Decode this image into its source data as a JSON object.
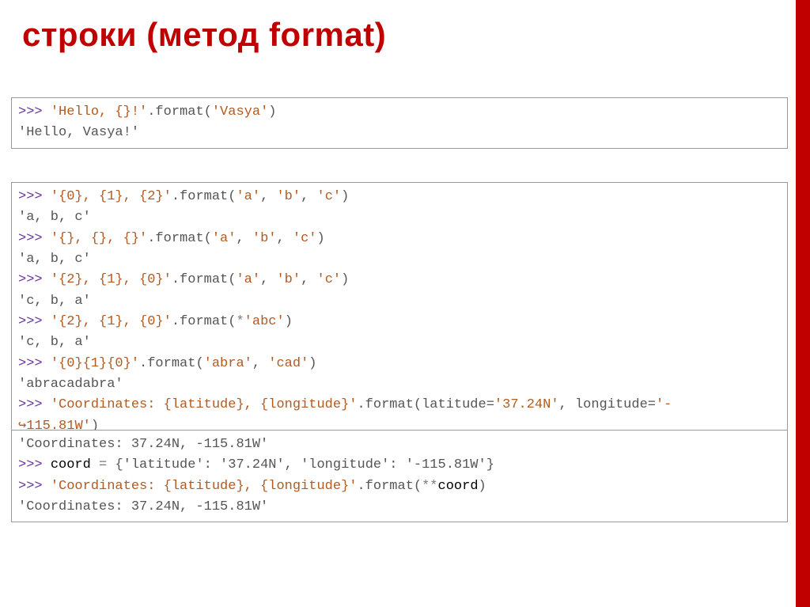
{
  "title": "строки (метод format)",
  "block1": {
    "l1": {
      "p": ">>> ",
      "code_a": "'Hello, {}!'",
      "code_b": ".format(",
      "code_c": "'Vasya'",
      "code_d": ")"
    },
    "l2": "'Hello, Vasya!'"
  },
  "block2": {
    "l1": {
      "p": ">>> ",
      "s": "'{0}, {1}, {2}'",
      "m": ".format(",
      "a": "'a'",
      "c1": ", ",
      "b": "'b'",
      "c2": ", ",
      "c": "'c'",
      "e": ")"
    },
    "l2": "'a, b, c'",
    "l3": {
      "p": ">>> ",
      "s": "'{}, {}, {}'",
      "m": ".format(",
      "a": "'a'",
      "c1": ", ",
      "b": "'b'",
      "c2": ", ",
      "c": "'c'",
      "e": ")"
    },
    "l4": "'a, b, c'",
    "l5": {
      "p": ">>> ",
      "s": "'{2}, {1}, {0}'",
      "m": ".format(",
      "a": "'a'",
      "c1": ", ",
      "b": "'b'",
      "c2": ", ",
      "c": "'c'",
      "e": ")"
    },
    "l6": "'c, b, a'",
    "l7": {
      "p": ">>> ",
      "s": "'{2}, {1}, {0}'",
      "m": ".format(",
      "star": "*",
      "arg": "'abc'",
      "e": ")"
    },
    "l8": "'c, b, a'",
    "l9": {
      "p": ">>> ",
      "s": "'{0}{1}{0}'",
      "m": ".format(",
      "a": "'abra'",
      "c1": ", ",
      "b": "'cad'",
      "e": ")"
    },
    "l10": "'abracadabra'",
    "l11": {
      "p": ">>> ",
      "s": "'Coordinates: {latitude}, {longitude}'",
      "m": ".format(latitude=",
      "a": "'37.24N'",
      "mid": ", longitude=",
      "b": "'-"
    },
    "l12": {
      "arrow": "↪",
      "rest": "115.81W'",
      "e": ")"
    }
  },
  "block3": {
    "l1": "'Coordinates: 37.24N, -115.81W'",
    "l2": {
      "p": ">>> ",
      "ident": "coord ",
      "eq": "= ",
      "dict": "{'latitude': '37.24N', 'longitude': '-115.81W'}"
    },
    "l3": {
      "p": ">>> ",
      "s": "'Coordinates: {latitude}, {longitude}'",
      "m": ".format(",
      "star": "**",
      "ident": "coord",
      "e": ")"
    },
    "l4": "'Coordinates: 37.24N, -115.81W'"
  }
}
